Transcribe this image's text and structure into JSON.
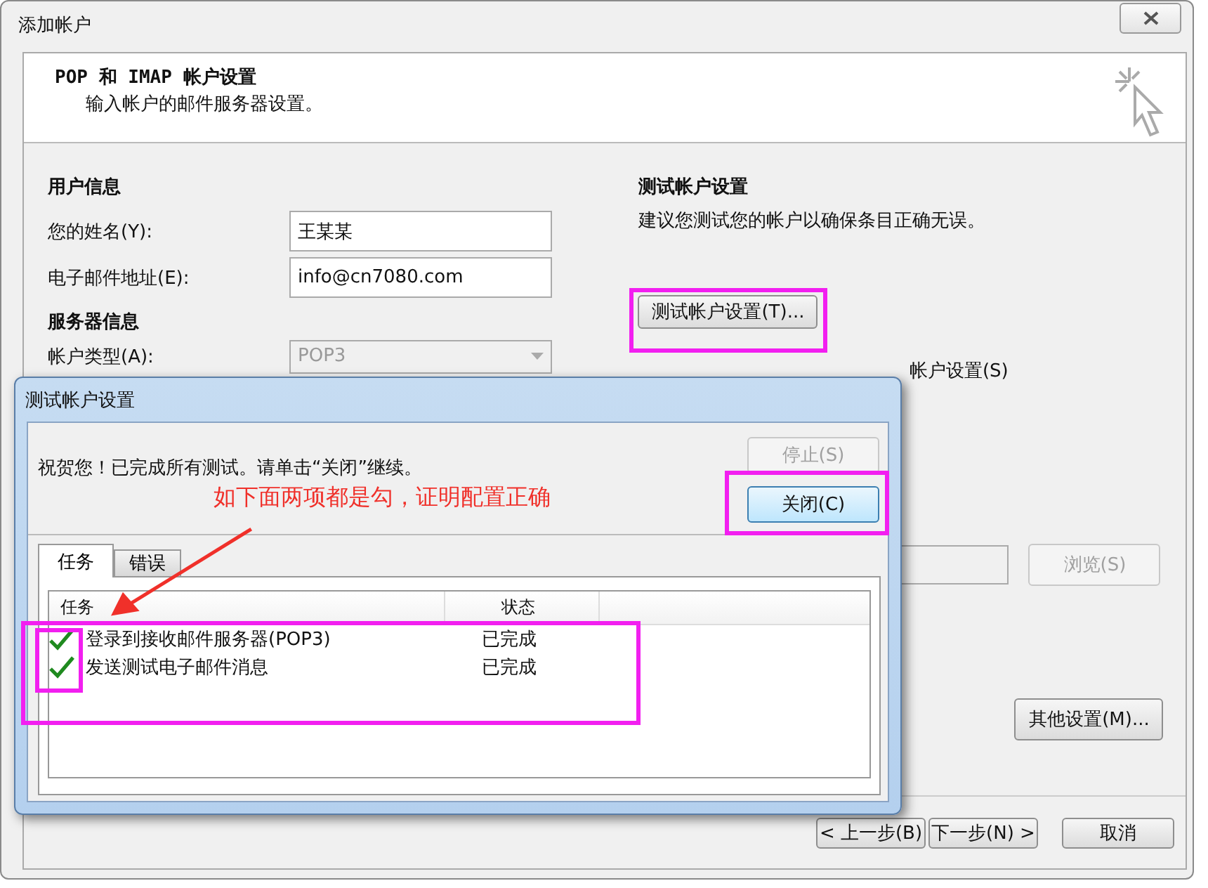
{
  "window": {
    "title": "添加帐户"
  },
  "header": {
    "title": "POP 和 IMAP 帐户设置",
    "subtitle": "输入帐户的邮件服务器设置。"
  },
  "user_info": {
    "heading": "用户信息",
    "fields": [
      {
        "label": "您的姓名(Y):",
        "value": "王某某"
      },
      {
        "label": "电子邮件地址(E):",
        "value": "info@cn7080.com"
      }
    ]
  },
  "server_info": {
    "heading": "服务器信息",
    "account_type": {
      "label": "帐户类型(A):",
      "value": "POP3",
      "disabled": true
    }
  },
  "test_settings": {
    "heading": "测试帐户设置",
    "description": "建议您测试您的帐户以确保条目正确无误。",
    "button": {
      "label": "测试帐户设置(T)...",
      "highlighted": true
    },
    "checkbox_label": "帐户设置(S)"
  },
  "browse_button": {
    "label": "浏览(S)",
    "disabled": true
  },
  "more_settings_button": {
    "label": "其他设置(M)..."
  },
  "footer_buttons": [
    {
      "label": "< 上一步(B)"
    },
    {
      "label": "下一步(N) >"
    },
    {
      "label": "取消"
    }
  ],
  "test_dialog": {
    "title": "测试帐户设置",
    "message": "祝贺您！已完成所有测试。请单击“关闭”继续。",
    "stop_button": {
      "label": "停止(S)",
      "disabled": true
    },
    "close_button": {
      "label": "关闭(C)",
      "highlighted": true
    },
    "tabs": [
      {
        "label": "任务",
        "selected": true
      },
      {
        "label": "错误",
        "selected": false
      }
    ],
    "table": {
      "columns": [
        "任务",
        "状态"
      ],
      "highlighted": true,
      "icons_highlighted": true,
      "rows": [
        {
          "task": "登录到接收邮件服务器(POP3)",
          "status": "已完成",
          "done": true
        },
        {
          "task": "发送测试电子邮件消息",
          "status": "已完成",
          "done": true
        }
      ]
    }
  },
  "annotation": {
    "note": "如下面两项都是勾，证明配置正确",
    "arrow": true
  }
}
